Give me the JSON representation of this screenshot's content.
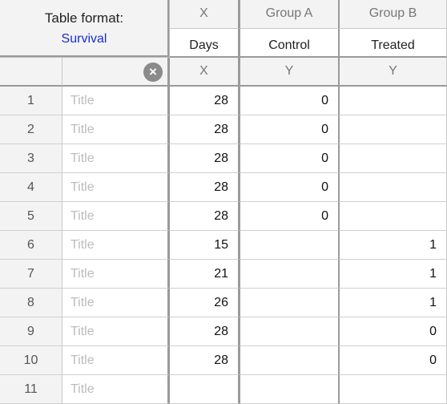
{
  "table_format": {
    "label": "Table format:",
    "value": "Survival"
  },
  "columns": [
    {
      "group": "X",
      "name": "Days",
      "type": "X"
    },
    {
      "group": "Group A",
      "name": "Control",
      "type": "Y"
    },
    {
      "group": "Group B",
      "name": "Treated",
      "type": "Y"
    }
  ],
  "title_placeholder": "Title",
  "rows": [
    {
      "num": "1",
      "x": "28",
      "a": "0",
      "b": ""
    },
    {
      "num": "2",
      "x": "28",
      "a": "0",
      "b": ""
    },
    {
      "num": "3",
      "x": "28",
      "a": "0",
      "b": ""
    },
    {
      "num": "4",
      "x": "28",
      "a": "0",
      "b": ""
    },
    {
      "num": "5",
      "x": "28",
      "a": "0",
      "b": ""
    },
    {
      "num": "6",
      "x": "15",
      "a": "",
      "b": "1"
    },
    {
      "num": "7",
      "x": "21",
      "a": "",
      "b": "1"
    },
    {
      "num": "8",
      "x": "26",
      "a": "",
      "b": "1"
    },
    {
      "num": "9",
      "x": "28",
      "a": "",
      "b": "0"
    },
    {
      "num": "10",
      "x": "28",
      "a": "",
      "b": "0"
    },
    {
      "num": "11",
      "x": "",
      "a": "",
      "b": ""
    }
  ],
  "icons": {
    "clear": "clear-x-icon"
  },
  "colors": {
    "format_value": "#1a2cd6",
    "header_bg": "#f3f3f3",
    "grid_line": "#9a9a9a"
  }
}
